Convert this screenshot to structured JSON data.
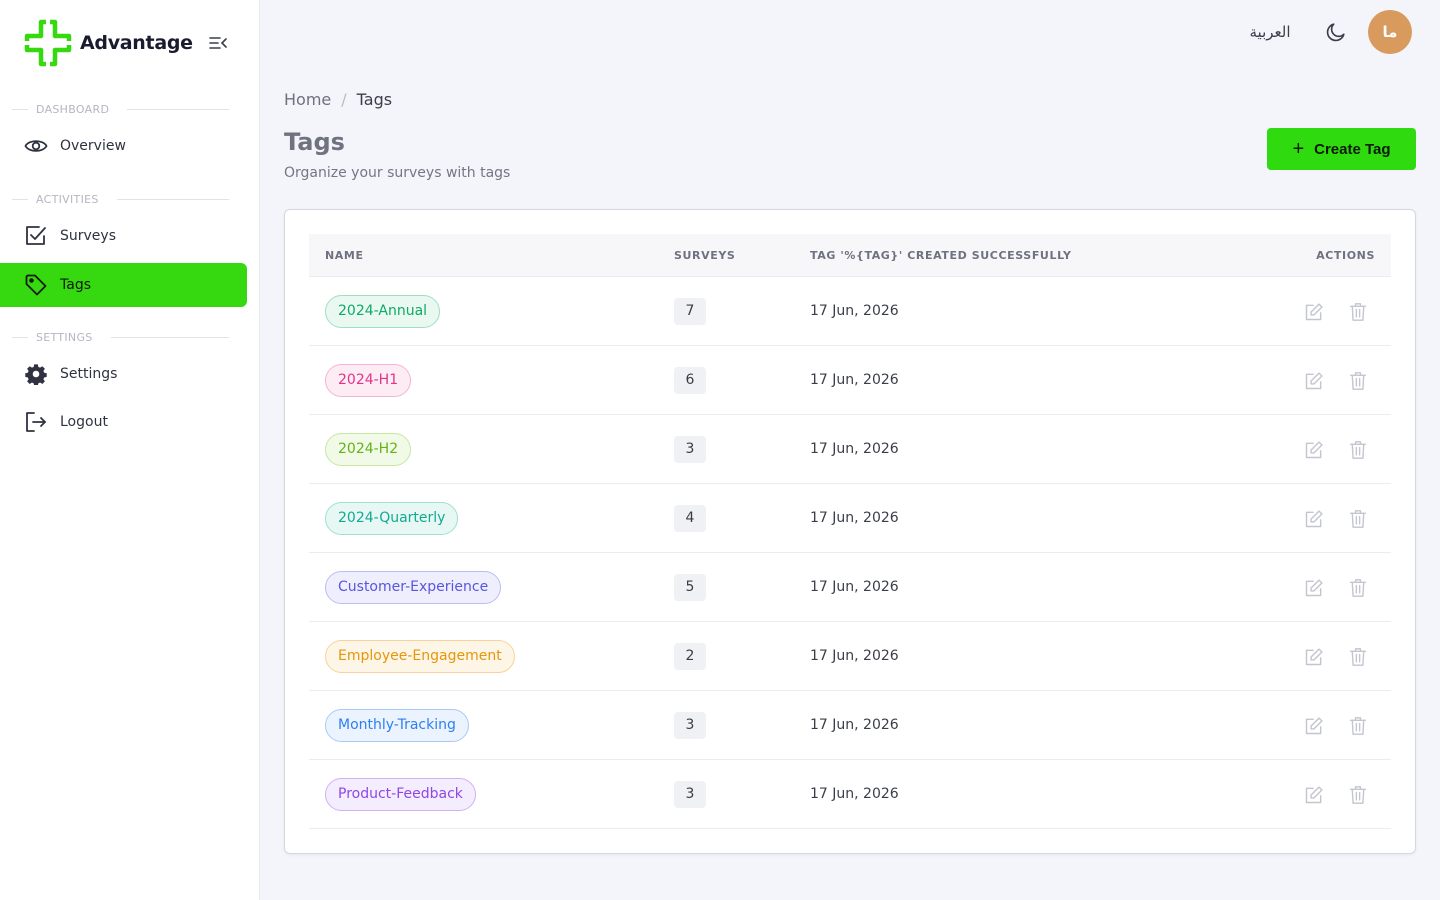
{
  "app": {
    "brand": "Advantage",
    "accent": "#36d810"
  },
  "sidebar": {
    "sections": [
      {
        "label": "DASHBOARD"
      },
      {
        "label": "ACTIVITIES"
      },
      {
        "label": "SETTINGS"
      }
    ],
    "items": [
      {
        "label": "Overview",
        "icon": "eye-icon",
        "active": false
      },
      {
        "label": "Surveys",
        "icon": "checkbox-icon",
        "active": false
      },
      {
        "label": "Tags",
        "icon": "tag-icon",
        "active": true
      },
      {
        "label": "Settings",
        "icon": "gear-icon",
        "active": false
      },
      {
        "label": "Logout",
        "icon": "logout-icon",
        "active": false
      }
    ]
  },
  "topbar": {
    "language": "العربية",
    "avatar_initials": "ما",
    "avatar_color": "#d99a5d"
  },
  "breadcrumb": {
    "home": "Home",
    "separator": "/",
    "current": "Tags"
  },
  "header": {
    "title": "Tags",
    "subtitle": "Organize your surveys with tags",
    "create_button": "Create Tag"
  },
  "table": {
    "columns": {
      "name": "NAME",
      "surveys": "SURVEYS",
      "created": "TAG '%{TAG}' CREATED SUCCESSFULLY",
      "actions": "ACTIONS"
    },
    "rows": [
      {
        "name": "2024-Annual",
        "surveys": "7",
        "date": "17 Jun, 2026",
        "color": "#0fa968",
        "bg": "#e9f8f0",
        "border": "#9fe0c0"
      },
      {
        "name": "2024-H1",
        "surveys": "6",
        "date": "17 Jun, 2026",
        "color": "#e0358a",
        "bg": "#fdecf4",
        "border": "#f5b3d3"
      },
      {
        "name": "2024-H2",
        "surveys": "3",
        "date": "17 Jun, 2026",
        "color": "#62b515",
        "bg": "#f1f9e7",
        "border": "#c5e8a3"
      },
      {
        "name": "2024-Quarterly",
        "surveys": "4",
        "date": "17 Jun, 2026",
        "color": "#12a993",
        "bg": "#e7f8f4",
        "border": "#9fdfd3"
      },
      {
        "name": "Customer-Experience",
        "surveys": "5",
        "date": "17 Jun, 2026",
        "color": "#5855e0",
        "bg": "#efeefd",
        "border": "#bdbcf3"
      },
      {
        "name": "Employee-Engagement",
        "surveys": "2",
        "date": "17 Jun, 2026",
        "color": "#e5960b",
        "bg": "#fdf5e6",
        "border": "#f6d39a"
      },
      {
        "name": "Monthly-Tracking",
        "surveys": "3",
        "date": "17 Jun, 2026",
        "color": "#2f7ff0",
        "bg": "#ebf3fe",
        "border": "#a8c9f7"
      },
      {
        "name": "Product-Feedback",
        "surveys": "3",
        "date": "17 Jun, 2026",
        "color": "#9047e6",
        "bg": "#f4edfd",
        "border": "#cfb1f4"
      }
    ]
  }
}
